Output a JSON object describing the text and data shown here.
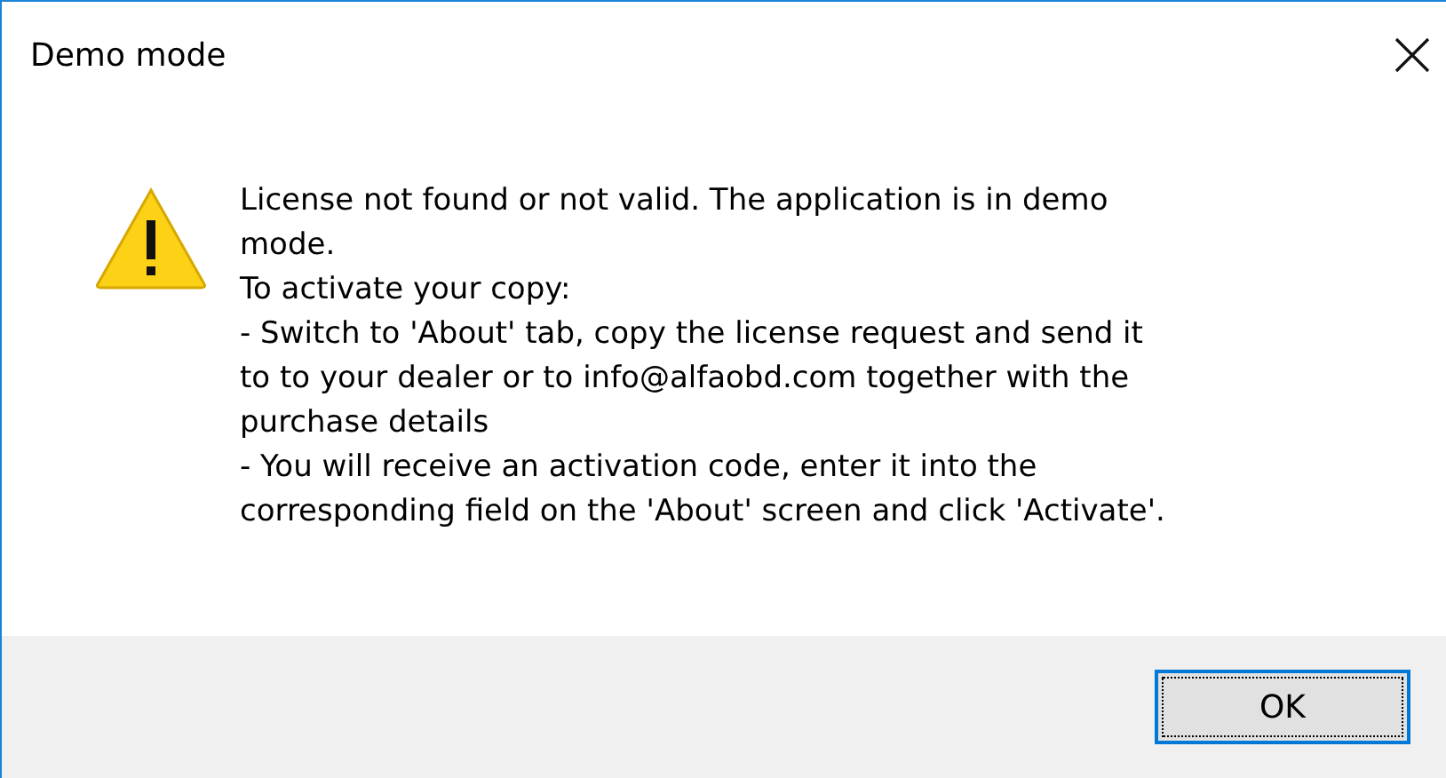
{
  "window": {
    "title": "Demo mode"
  },
  "message": {
    "lines": [
      "License not found or not valid. The application is in demo",
      "mode.",
      "To activate your copy:",
      "- Switch to 'About' tab, copy the license request and send it",
      "to to your dealer or to info@alfaobd.com together with the",
      "purchase details",
      "- You will receive an activation code, enter it into the",
      "corresponding field on the 'About' screen and click 'Activate'."
    ]
  },
  "buttons": [
    {
      "label": "OK",
      "selected": true
    }
  ]
}
